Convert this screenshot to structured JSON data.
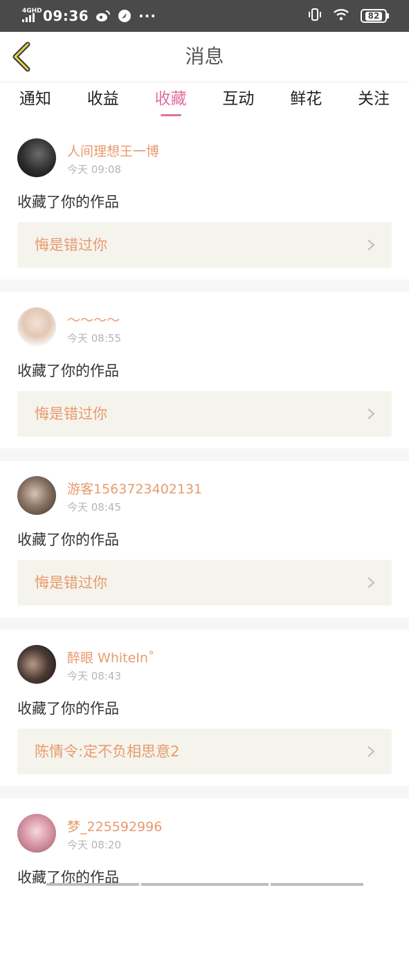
{
  "status_bar": {
    "network": "4GHD",
    "time": "09:36",
    "icons": [
      "weibo-icon",
      "compass-icon",
      "more-dots-icon",
      "vibrate-icon",
      "wifi-icon"
    ],
    "dots": "···",
    "battery": "82"
  },
  "header": {
    "title": "消息",
    "back_icon": "chevron-left-icon"
  },
  "tabs": [
    {
      "label": "通知",
      "active": false
    },
    {
      "label": "收益",
      "active": false
    },
    {
      "label": "收藏",
      "active": true
    },
    {
      "label": "互动",
      "active": false
    },
    {
      "label": "鲜花",
      "active": false
    },
    {
      "label": "关注",
      "active": false
    }
  ],
  "colors": {
    "accent": "#e06fa0",
    "name_color": "#e89a6e",
    "card_bg": "#f5f4ec",
    "status_bar": "#4a4a4a"
  },
  "notifications": [
    {
      "username": "人间理想王一博",
      "time": "今天 09:08",
      "action": "收藏了你的作品",
      "work": "悔是错过你"
    },
    {
      "username": "～～～～",
      "time": "今天 08:55",
      "action": "收藏了你的作品",
      "work": "悔是错过你"
    },
    {
      "username": "游客1563723402131",
      "time": "今天 08:45",
      "action": "收藏了你的作品",
      "work": "悔是错过你"
    },
    {
      "username": "醉眼 WhiteIn˚",
      "time": "今天 08:43",
      "action": "收藏了你的作品",
      "work": "陈情令:定不负相思意2"
    },
    {
      "username": "梦_225592996",
      "time": "今天 08:20",
      "action": "收藏了你的作品",
      "work": ""
    }
  ]
}
